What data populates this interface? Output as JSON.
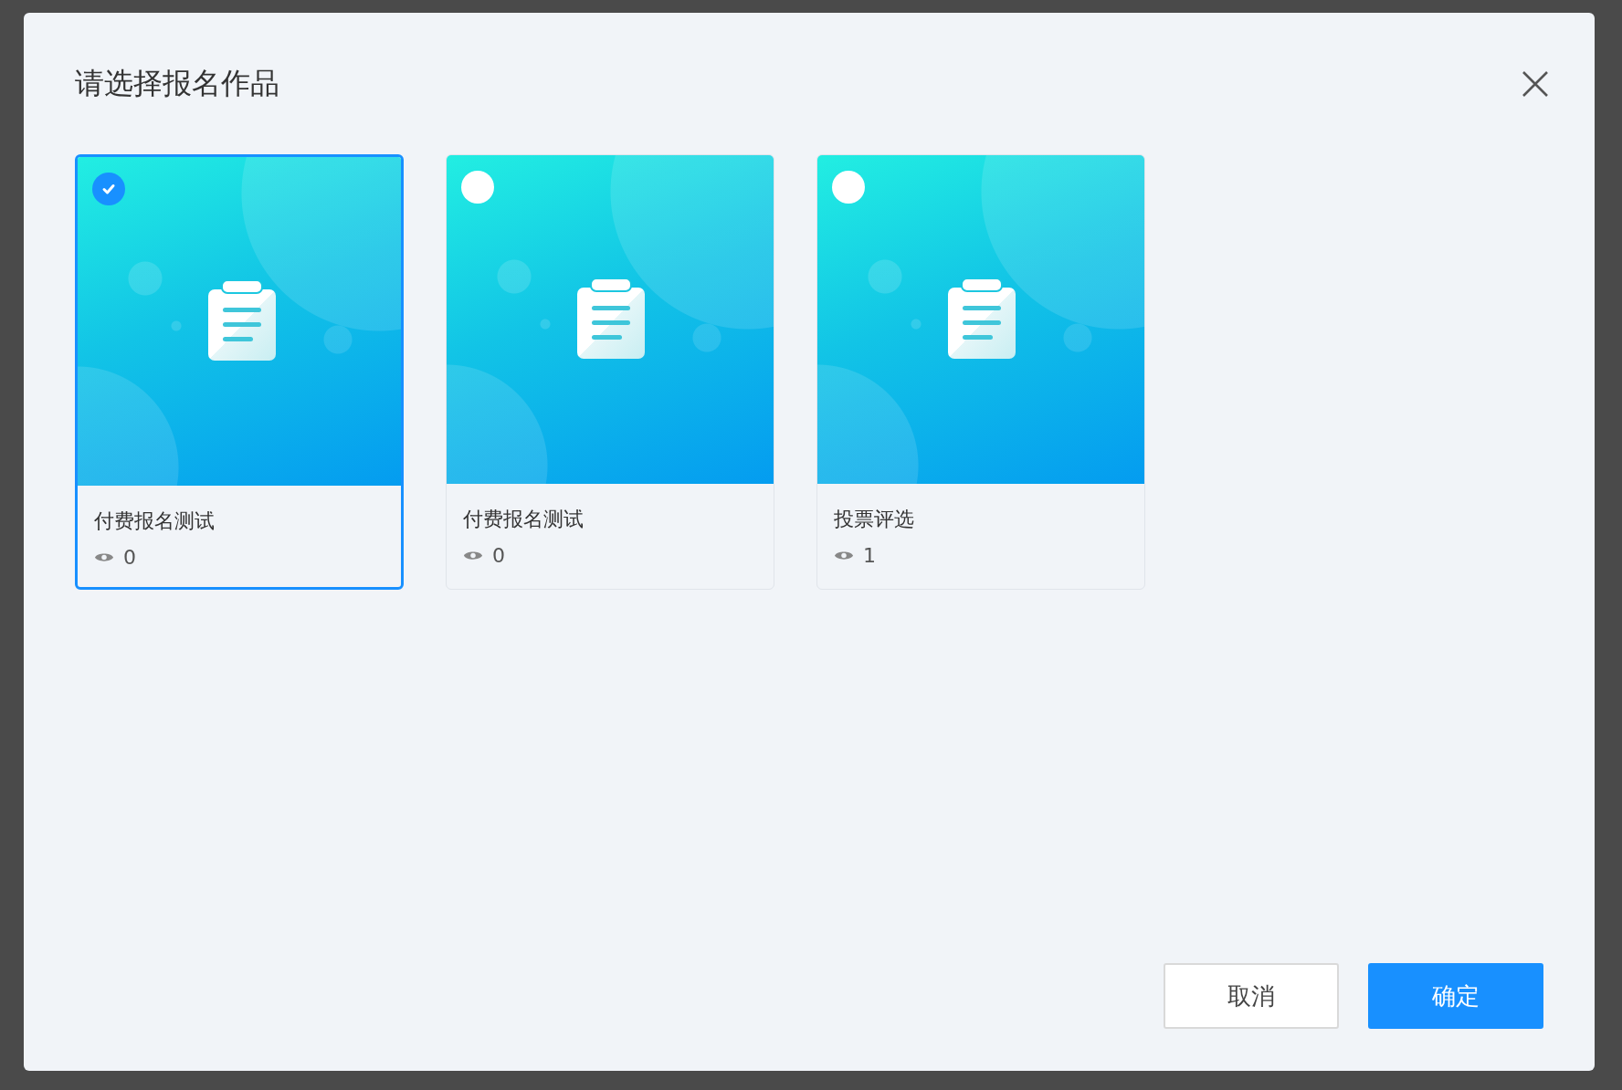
{
  "dialog": {
    "title": "请选择报名作品"
  },
  "works": [
    {
      "title": "付费报名测试",
      "views": "0",
      "selected": true
    },
    {
      "title": "付费报名测试",
      "views": "0",
      "selected": false
    },
    {
      "title": "投票评选",
      "views": "1",
      "selected": false
    }
  ],
  "buttons": [
    {
      "label": "取消",
      "kind": "secondary"
    },
    {
      "label": "确定",
      "kind": "primary"
    }
  ]
}
